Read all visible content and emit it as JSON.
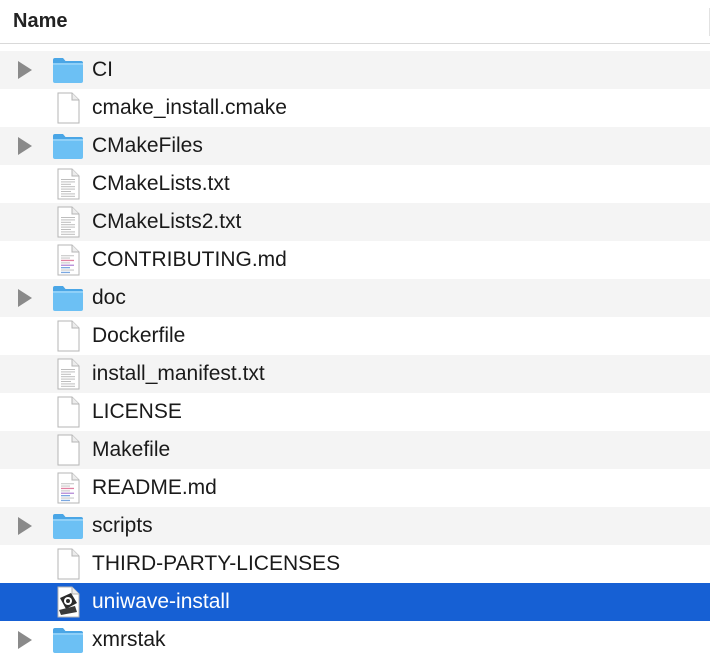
{
  "header": {
    "name_label": "Name"
  },
  "colors": {
    "selection": "#1660d4",
    "folder": "#6cc0f4",
    "stripe": "#f4f4f4"
  },
  "files": [
    {
      "name": "CI",
      "kind": "folder",
      "icon": "folder-icon",
      "expandable": true
    },
    {
      "name": "cmake_install.cmake",
      "kind": "blank",
      "icon": "document-icon",
      "expandable": false
    },
    {
      "name": "CMakeFiles",
      "kind": "folder",
      "icon": "folder-icon",
      "expandable": true
    },
    {
      "name": "CMakeLists.txt",
      "kind": "text",
      "icon": "text-document-icon",
      "expandable": false
    },
    {
      "name": "CMakeLists2.txt",
      "kind": "text",
      "icon": "text-document-icon",
      "expandable": false
    },
    {
      "name": "CONTRIBUTING.md",
      "kind": "markdown",
      "icon": "markdown-document-icon",
      "expandable": false
    },
    {
      "name": "doc",
      "kind": "folder",
      "icon": "folder-icon",
      "expandable": true
    },
    {
      "name": "Dockerfile",
      "kind": "blank",
      "icon": "document-icon",
      "expandable": false
    },
    {
      "name": "install_manifest.txt",
      "kind": "text",
      "icon": "text-document-icon",
      "expandable": false
    },
    {
      "name": "LICENSE",
      "kind": "blank",
      "icon": "document-icon",
      "expandable": false
    },
    {
      "name": "Makefile",
      "kind": "blank",
      "icon": "document-icon",
      "expandable": false
    },
    {
      "name": "README.md",
      "kind": "markdown",
      "icon": "markdown-document-icon",
      "expandable": false
    },
    {
      "name": "scripts",
      "kind": "folder",
      "icon": "folder-icon",
      "expandable": true
    },
    {
      "name": "THIRD-PARTY-LICENSES",
      "kind": "blank",
      "icon": "document-icon",
      "expandable": false
    },
    {
      "name": "uniwave-install",
      "kind": "exec",
      "icon": "installer-icon",
      "expandable": false,
      "selected": true
    },
    {
      "name": "xmrstak",
      "kind": "folder",
      "icon": "folder-icon",
      "expandable": true
    }
  ]
}
